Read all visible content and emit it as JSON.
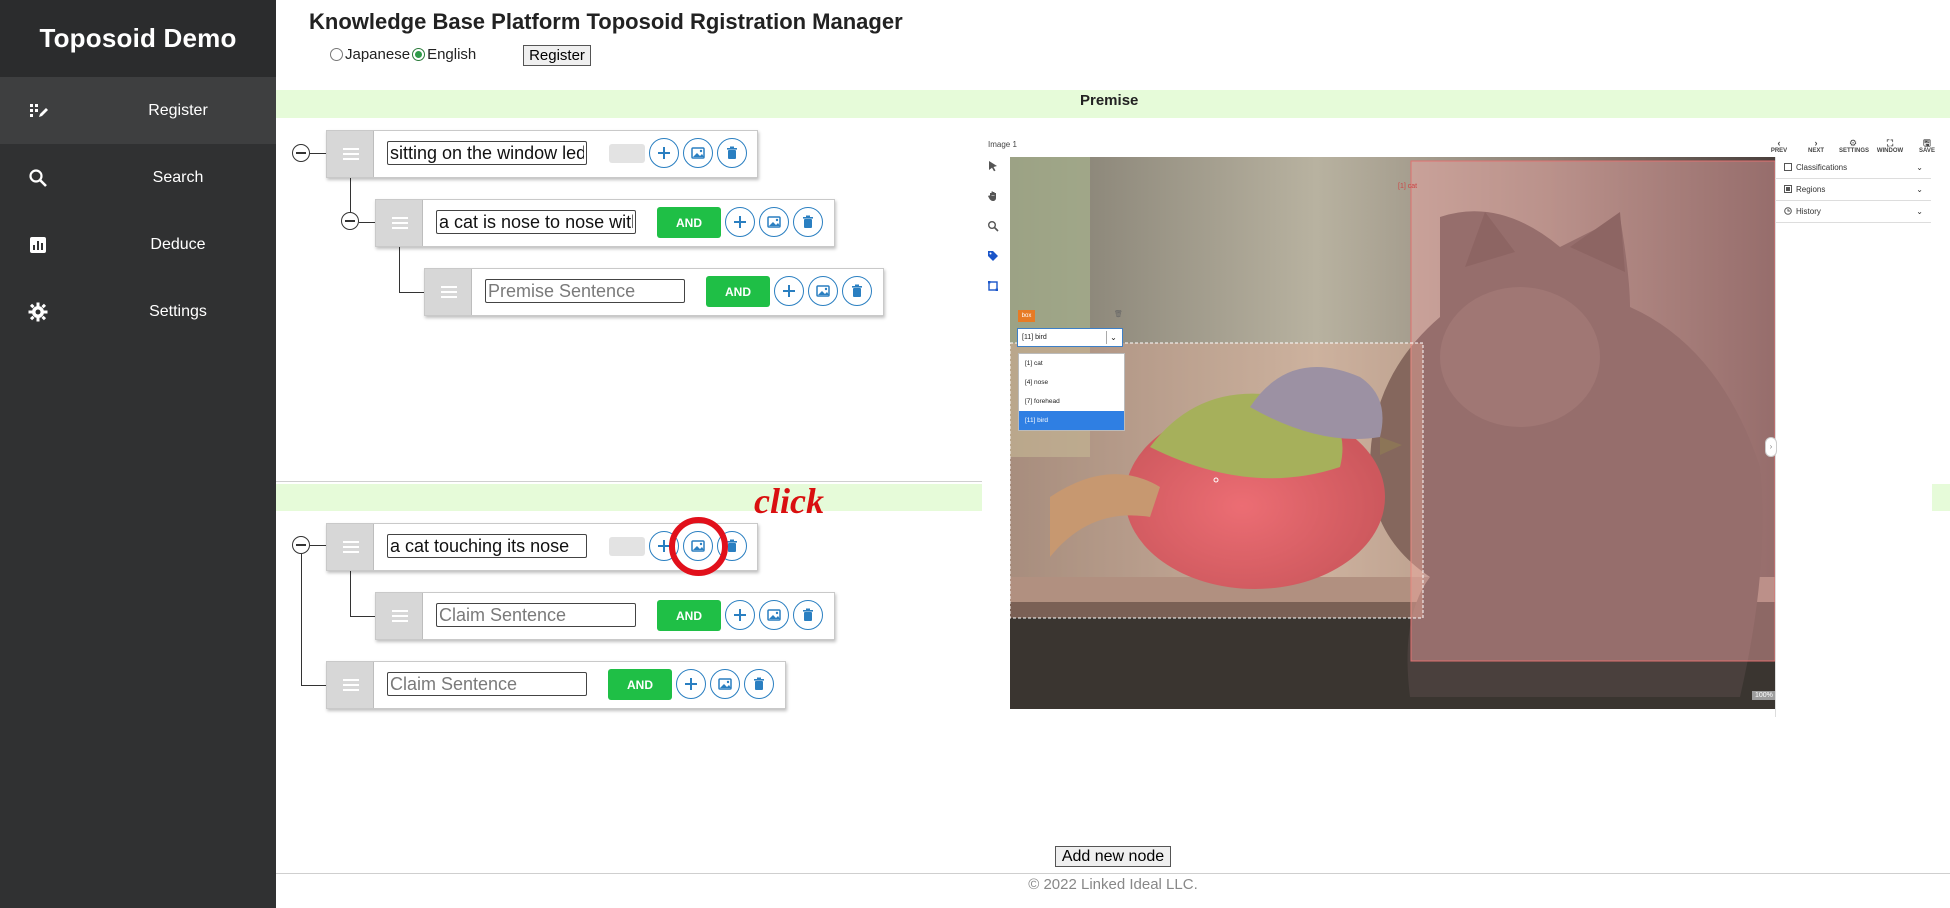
{
  "sidebar": {
    "brand": "Toposoid Demo",
    "items": [
      {
        "label": "Register",
        "icon": "register-icon",
        "active": true
      },
      {
        "label": "Search",
        "icon": "search-icon"
      },
      {
        "label": "Deduce",
        "icon": "chart-icon"
      },
      {
        "label": "Settings",
        "icon": "gear-icon"
      }
    ]
  },
  "header": {
    "title": "Knowledge Base Platform Toposoid Rgistration Manager",
    "languages": [
      {
        "label": "Japanese",
        "checked": false
      },
      {
        "label": "English",
        "checked": true
      }
    ],
    "register_label": "Register"
  },
  "premise": {
    "label": "Premise",
    "nodes": [
      {
        "value": "sitting on the window ledge",
        "placeholder": "Premise Sentence"
      },
      {
        "value": "a cat is nose to nose with",
        "placeholder": "Premise Sentence",
        "and_label": "AND"
      },
      {
        "value": "",
        "placeholder": "Premise Sentence",
        "and_label": "AND"
      }
    ]
  },
  "claim": {
    "nodes": [
      {
        "value": "a cat touching its nose",
        "placeholder": "Claim Sentence"
      },
      {
        "value": "",
        "placeholder": "Claim Sentence",
        "and_label": "AND"
      },
      {
        "value": "",
        "placeholder": "Claim Sentence",
        "and_label": "AND"
      }
    ]
  },
  "annotation": {
    "text": "click",
    "color": "#e1101b"
  },
  "image_editor": {
    "image_label": "Image 1",
    "top_tools": [
      {
        "glyph": "‹",
        "label": "PREV"
      },
      {
        "glyph": "›",
        "label": "NEXT"
      },
      {
        "glyph": "⚙",
        "label": "SETTINGS"
      },
      {
        "glyph": "⛶",
        "label": "WINDOW"
      },
      {
        "glyph": "🖫",
        "label": "SAVE"
      }
    ],
    "panels": [
      "Classifications",
      "Regions",
      "History"
    ],
    "region_label": "[1] cat",
    "zoom": "100%",
    "tag": "box",
    "selected_class": "[11] bird",
    "class_options": [
      "[1] cat",
      "[4] nose",
      "[7] forehead",
      "[11] bird"
    ],
    "highlighted_option": 3
  },
  "footer": {
    "add_node_label": "Add new node",
    "copyright": "© 2022 Linked Ideal LLC."
  },
  "colors": {
    "sidebar_bg": "#303132",
    "band_green": "#e6fbd9",
    "and_green": "#1fbf46",
    "circle_blue": "#2a7fc1"
  }
}
